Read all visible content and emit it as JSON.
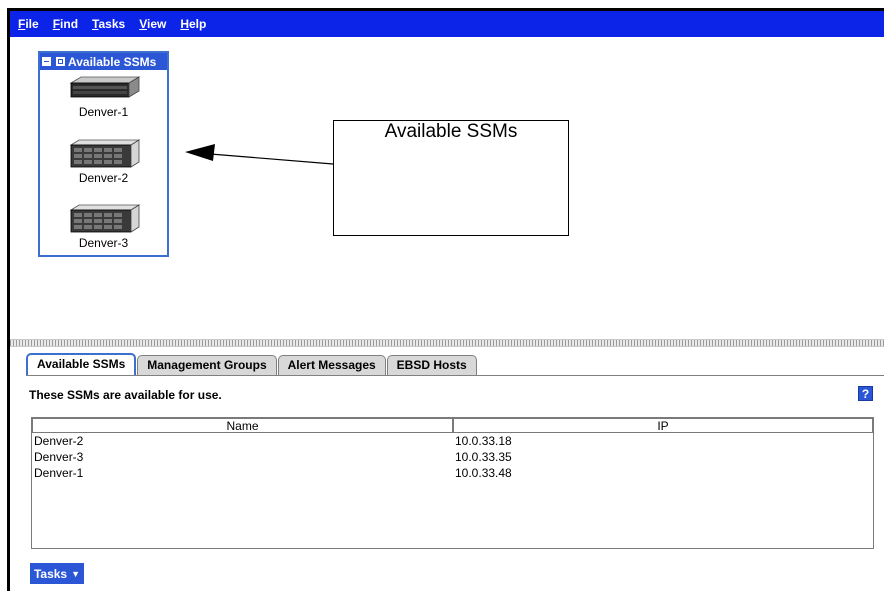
{
  "menubar": {
    "items": [
      {
        "label": "File"
      },
      {
        "label": "Find"
      },
      {
        "label": "Tasks"
      },
      {
        "label": "View"
      },
      {
        "label": "Help"
      }
    ]
  },
  "ssm_group": {
    "title": "Available SSMs",
    "devices": [
      {
        "label": "Denver-1"
      },
      {
        "label": "Denver-2"
      },
      {
        "label": "Denver-3"
      }
    ]
  },
  "callout": {
    "text": "Available SSMs"
  },
  "tabs": [
    {
      "label": "Available SSMs",
      "active": true
    },
    {
      "label": "Management Groups",
      "active": false
    },
    {
      "label": "Alert Messages",
      "active": false
    },
    {
      "label": "EBSD Hosts",
      "active": false
    }
  ],
  "panel": {
    "description": "These SSMs are available for use.",
    "help_label": "?"
  },
  "table": {
    "columns": [
      "Name",
      "IP"
    ],
    "rows": [
      {
        "name": "Denver-2",
        "ip": "10.0.33.18"
      },
      {
        "name": "Denver-3",
        "ip": "10.0.33.35"
      },
      {
        "name": "Denver-1",
        "ip": "10.0.33.48"
      }
    ]
  },
  "tasks_button": {
    "label": "Tasks"
  },
  "colors": {
    "menubar": "#0c24e8",
    "accent": "#2b56d6"
  }
}
